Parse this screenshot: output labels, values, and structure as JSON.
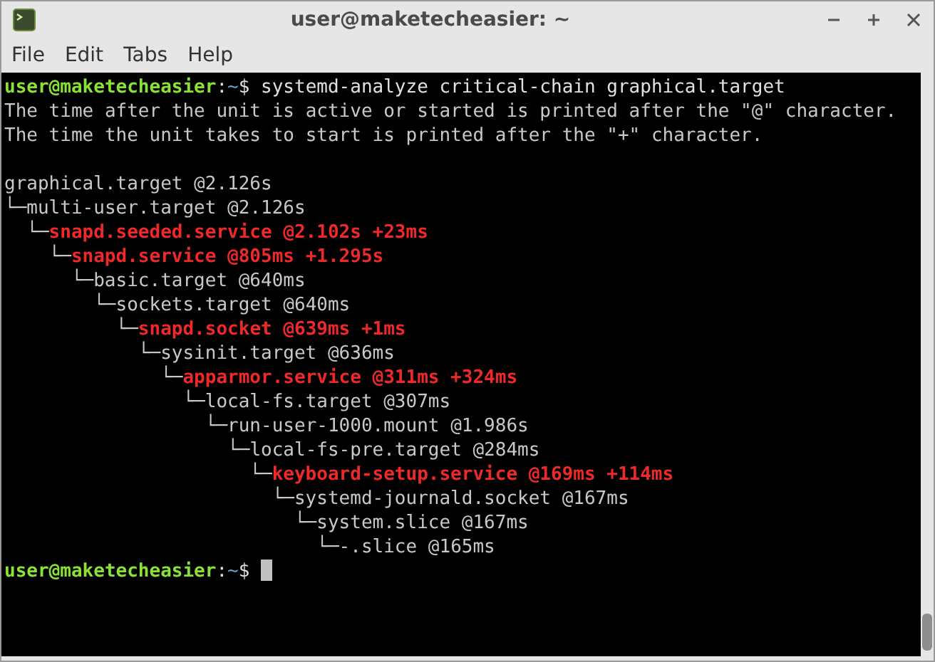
{
  "window": {
    "title": "user@maketecheasier: ~"
  },
  "menu": [
    "File",
    "Edit",
    "Tabs",
    "Help"
  ],
  "terminal": {
    "command_prompt": {
      "user_host": "user@maketecheasier",
      "separator": ":",
      "path": "~",
      "symbol": "$",
      "command": "systemd-analyze critical-chain graphical.target"
    },
    "notes": [
      "The time after the unit is active or started is printed after the \"@\" character.",
      "The time the unit takes to start is printed after the \"+\" character."
    ],
    "tree": {
      "unit": "graphical.target @2.126s",
      "highlighted": false,
      "children": [
        {
          "branch": "└─",
          "unit": "multi-user.target @2.126s",
          "highlighted": false,
          "children": [
            {
              "branch": "└─",
              "unit": "snapd.seeded.service @2.102s +23ms",
              "highlighted": true,
              "children": [
                {
                  "branch": "└─",
                  "unit": "snapd.service @805ms +1.295s",
                  "highlighted": true,
                  "children": [
                    {
                      "branch": "└─",
                      "unit": "basic.target @640ms",
                      "highlighted": false,
                      "children": [
                        {
                          "branch": "└─",
                          "unit": "sockets.target @640ms",
                          "highlighted": false,
                          "children": [
                            {
                              "branch": "└─",
                              "unit": "snapd.socket @639ms +1ms",
                              "highlighted": true,
                              "children": [
                                {
                                  "branch": "└─",
                                  "unit": "sysinit.target @636ms",
                                  "highlighted": false,
                                  "children": [
                                    {
                                      "branch": "└─",
                                      "unit": "apparmor.service @311ms +324ms",
                                      "highlighted": true,
                                      "children": [
                                        {
                                          "branch": "└─",
                                          "unit": "local-fs.target @307ms",
                                          "highlighted": false,
                                          "children": [
                                            {
                                              "branch": "└─",
                                              "unit": "run-user-1000.mount @1.986s",
                                              "highlighted": false,
                                              "children": [
                                                {
                                                  "branch": "└─",
                                                  "unit": "local-fs-pre.target @284ms",
                                                  "highlighted": false,
                                                  "children": [
                                                    {
                                                      "branch": "└─",
                                                      "unit": "keyboard-setup.service @169ms +114ms",
                                                      "highlighted": true,
                                                      "children": [
                                                        {
                                                          "branch": "└─",
                                                          "unit": "systemd-journald.socket @167ms",
                                                          "highlighted": false,
                                                          "children": [
                                                            {
                                                              "branch": "└─",
                                                              "unit": "system.slice @167ms",
                                                              "highlighted": false,
                                                              "children": [
                                                                {
                                                                  "branch": "└─",
                                                                  "unit": "-.slice @165ms",
                                                                  "highlighted": false
                                                                }
                                                              ]
                                                            }
                                                          ]
                                                        }
                                                      ]
                                                    }
                                                  ]
                                                }
                                              ]
                                            }
                                          ]
                                        }
                                      ]
                                    }
                                  ]
                                }
                              ]
                            }
                          ]
                        }
                      ]
                    }
                  ]
                }
              ]
            }
          ]
        }
      ]
    },
    "idle_prompt": {
      "user_host": "user@maketecheasier",
      "separator": ":",
      "path": "~",
      "symbol": "$"
    }
  }
}
